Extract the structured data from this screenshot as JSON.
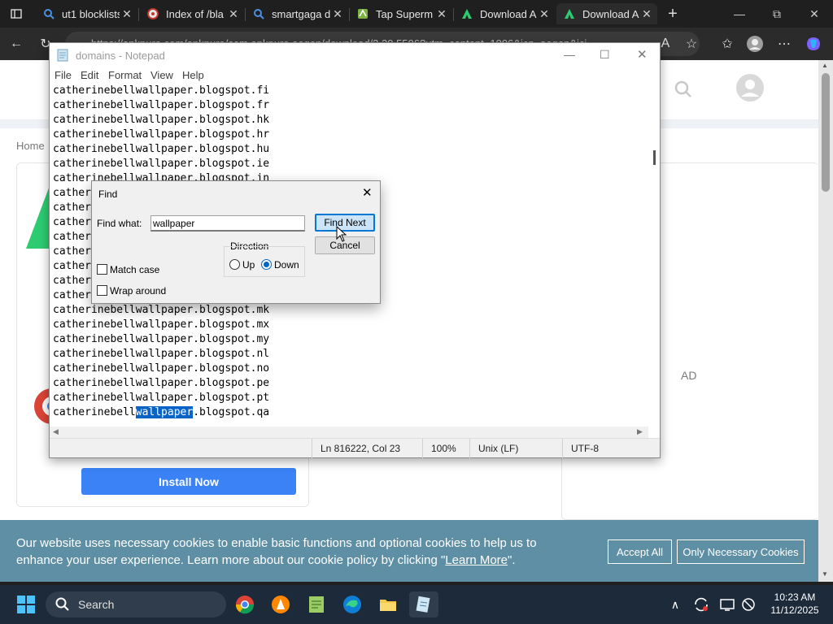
{
  "browser": {
    "tabs": [
      {
        "title": "ut1 blocklists",
        "icon": "search-icon"
      },
      {
        "title": "Index of /bla",
        "icon": "globe-icon"
      },
      {
        "title": "smartgaga d",
        "icon": "search-icon"
      },
      {
        "title": "Tap Superm",
        "icon": "app-icon"
      },
      {
        "title": "Download A",
        "icon": "android-icon"
      },
      {
        "title": "Download A",
        "icon": "android-icon"
      }
    ],
    "url": "https://apkpure.com/apkpure/com.apkpure.aegon/download/3.20.5506?utm_content=1006&icn=aegon&ici=",
    "window_controls": {
      "minimize": "—",
      "maximize": "⧉",
      "close": "✕"
    }
  },
  "webpage": {
    "breadcrumb": "Home",
    "install_label": "Install Now",
    "ad_label": "AD",
    "cookie": {
      "text_before": "Our website uses necessary cookies to enable basic functions and optional cookies to help us to enhance your user experience. Learn more about our cookie policy by clicking \"",
      "link": "Learn More",
      "text_after": "\".",
      "accept_all": "Accept All",
      "only_necessary": "Only Necessary Cookies"
    }
  },
  "notepad": {
    "title": "domains - Notepad",
    "menu": [
      "File",
      "Edit",
      "Format",
      "View",
      "Help"
    ],
    "lines": [
      "catherinebellwallpaper.blogspot.fi",
      "catherinebellwallpaper.blogspot.fr",
      "catherinebellwallpaper.blogspot.hk",
      "catherinebellwallpaper.blogspot.hr",
      "catherinebellwallpaper.blogspot.hu",
      "catherinebellwallpaper.blogspot.ie",
      "catherinebellwallpaper.blogspot.in",
      "catherinebellwallpaper.blogspot.is",
      "catherinebellwallpaper.blogspot.it",
      "catherinebellwallpaper.blogspot.jp",
      "catherinebellwallpaper.blogspot.kr",
      "catherinebellwallpaper.blogspot.li",
      "catherinebellwallpaper.blogspot.lt",
      "catherinebellwallpaper.blogspot.lu",
      "catherinebellwallpaper.blogspot.md",
      "catherinebellwallpaper.blogspot.mk",
      "catherinebellwallpaper.blogspot.mx",
      "catherinebellwallpaper.blogspot.my",
      "catherinebellwallpaper.blogspot.nl",
      "catherinebellwallpaper.blogspot.no",
      "catherinebellwallpaper.blogspot.pe",
      "catherinebellwallpaper.blogspot.pt"
    ],
    "highlight_line": {
      "before": "catherinebell",
      "match": "wallpaper",
      "after": ".blogspot.qa"
    },
    "status": {
      "position": "Ln 816222, Col 23",
      "zoom": "100%",
      "line_ending": "Unix (LF)",
      "encoding": "UTF-8"
    }
  },
  "find_dialog": {
    "title": "Find",
    "find_what_label": "Find what:",
    "find_what_value": "wallpaper",
    "find_next": "Find Next",
    "cancel": "Cancel",
    "direction_label": "Direction",
    "up_label": "Up",
    "down_label": "Down",
    "direction_selected": "Down",
    "match_case_label": "Match case",
    "wrap_around_label": "Wrap around"
  },
  "taskbar": {
    "search_placeholder": "Search",
    "time": "10:23 AM",
    "date": "11/12/2025"
  }
}
